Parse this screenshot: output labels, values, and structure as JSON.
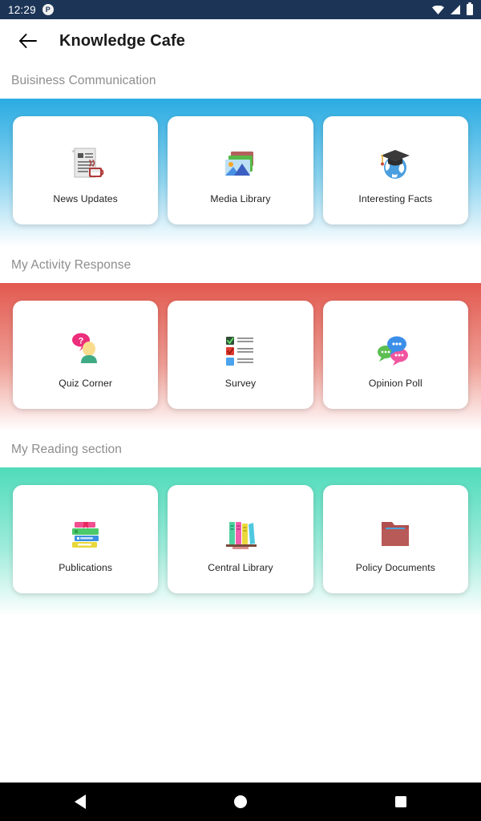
{
  "status_bar": {
    "time": "12:29",
    "badge_icon": "app-notification-icon",
    "icons": [
      "wifi-icon",
      "signal-icon",
      "battery-icon"
    ],
    "background_color": "#1c3557"
  },
  "app_bar": {
    "back_icon": "back-arrow-icon",
    "title": "Knowledge Cafe"
  },
  "sections": [
    {
      "title": "Buisiness Communication",
      "band_color": "#29abe2",
      "items": [
        {
          "label": "News Updates",
          "icon": "newspaper-coffee-icon"
        },
        {
          "label": "Media Library",
          "icon": "photo-stack-icon"
        },
        {
          "label": "Interesting Facts",
          "icon": "globe-graduation-cap-icon"
        }
      ]
    },
    {
      "title": "My Activity Response",
      "band_color": "#e2594f",
      "items": [
        {
          "label": "Quiz Corner",
          "icon": "person-question-bubble-icon"
        },
        {
          "label": "Survey",
          "icon": "checklist-icon"
        },
        {
          "label": "Opinion Poll",
          "icon": "speech-bubbles-icon"
        }
      ]
    },
    {
      "title": "My Reading section",
      "band_color": "#4fdbba",
      "items": [
        {
          "label": "Publications",
          "icon": "book-stack-icon"
        },
        {
          "label": "Central Library",
          "icon": "bookshelf-icon"
        },
        {
          "label": "Policy Documents",
          "icon": "folder-documents-icon"
        }
      ]
    }
  ],
  "nav_bar": {
    "back": "nav-back-icon",
    "home": "nav-home-icon",
    "recents": "nav-recents-icon"
  }
}
